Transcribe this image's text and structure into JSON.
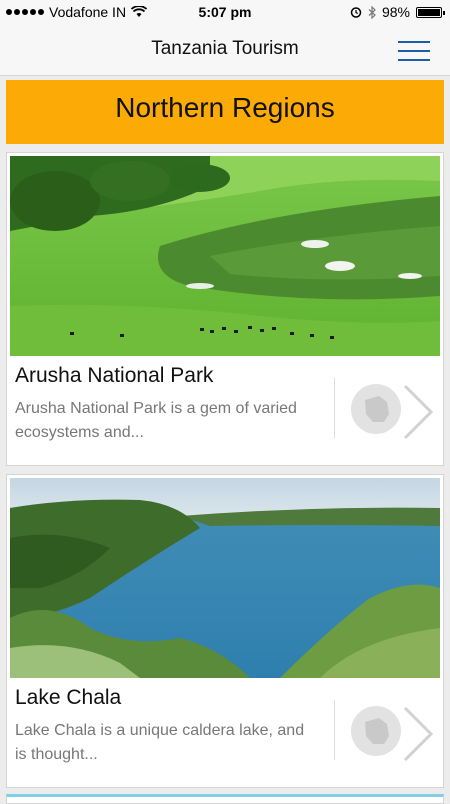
{
  "status_bar": {
    "carrier": "Vodafone IN",
    "time": "5:07 pm",
    "battery": "98%",
    "battery_level": 0.98,
    "icons": [
      "signal-dots-icon",
      "wifi-icon",
      "alarm-icon",
      "bluetooth-icon",
      "battery-icon"
    ]
  },
  "navbar": {
    "title": "Tanzania Tourism",
    "menu_icon": "hamburger-menu-icon",
    "accent": "#1a5ea8"
  },
  "region": {
    "title": "Northern Regions",
    "color": "#fbaa06"
  },
  "destinations": [
    {
      "name": "Arusha National Park",
      "description": "Arusha National Park is a gem of varied ecosystems and...",
      "image": "green grassland with herds"
    },
    {
      "name": "Lake Chala",
      "description": "Lake Chala is a unique caldera lake, and is thought...",
      "image": "blue crater lake with cliffs"
    }
  ]
}
